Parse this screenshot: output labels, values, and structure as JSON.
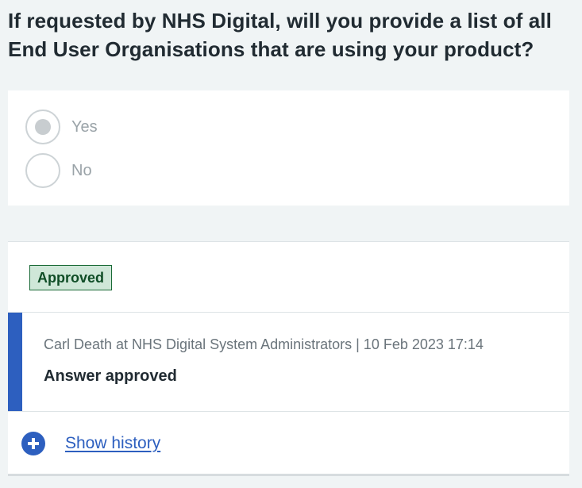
{
  "question": {
    "title": "If requested by NHS Digital, will you provide a list of all End User Organisations that are using your product?"
  },
  "options": [
    {
      "label": "Yes",
      "selected": true,
      "disabled": true
    },
    {
      "label": "No",
      "selected": false,
      "disabled": true
    }
  ],
  "review": {
    "status": "Approved",
    "status_colors": {
      "background": "#cfe7d8",
      "border": "#1a6a36",
      "text": "#0f4d26"
    },
    "comment": {
      "meta": "Carl Death at NHS Digital System Administrators | 10 Feb 2023 17:14",
      "text": "Answer approved",
      "accent_color": "#2d5fbf"
    },
    "history": {
      "icon": "plus-circle-icon",
      "label": "Show history"
    }
  }
}
